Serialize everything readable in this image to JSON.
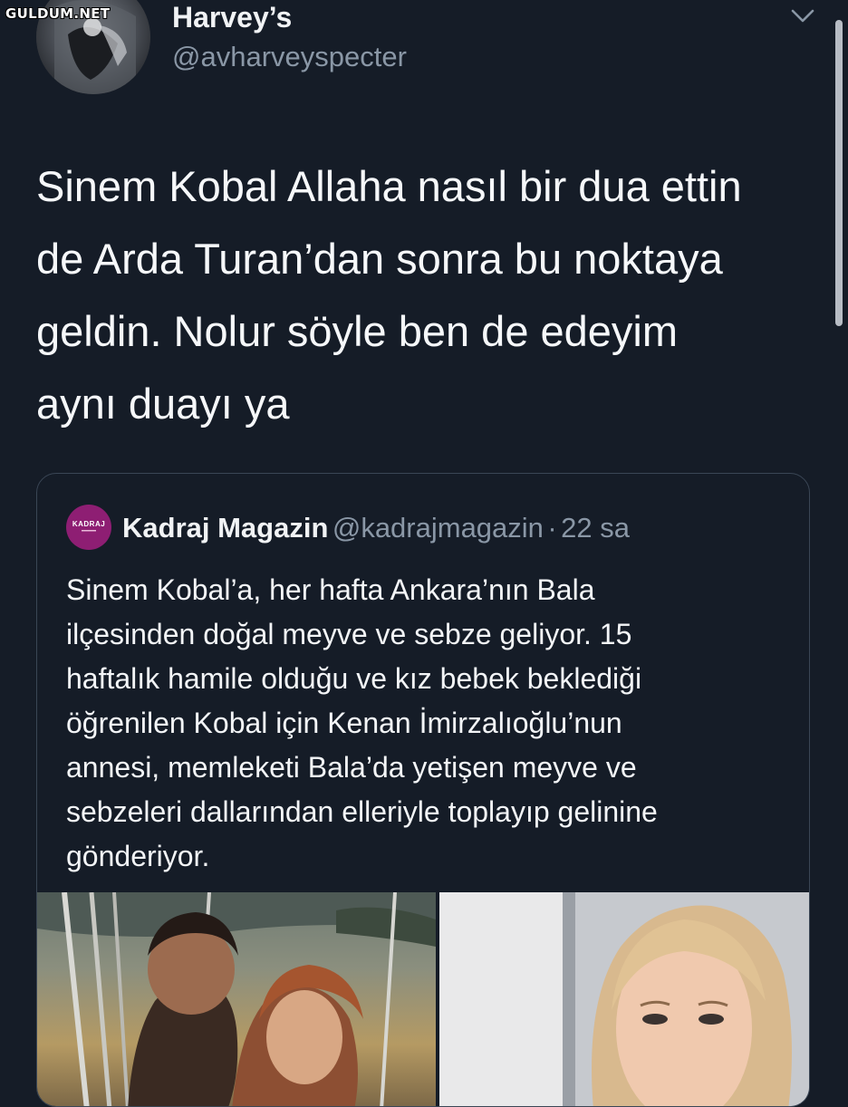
{
  "watermark": "GULDUM.NET",
  "tweet": {
    "author_name": "Harvey’s",
    "author_handle": "@avharveyspecter",
    "menu_icon": "chevron-down-icon",
    "text": "Sinem Kobal Allaha nasıl bir dua ettin\nde Arda Turan’dan sonra bu noktaya\ngeldin. Nolur söyle ben de edeyim\naynı duayı ya"
  },
  "quoted_tweet": {
    "avatar_text": "KADRAJ",
    "author_name": "Kadraj Magazin",
    "author_handle": "@kadrajmagazin",
    "separator": "·",
    "time": "22 sa",
    "text": "Sinem Kobal’a, her hafta Ankara’nın Bala\nilçesinden doğal meyve ve sebze geliyor. 15\nhaftalık hamile olduğu ve kız bebek beklediği\nöğrenilen Kobal için Kenan İmirzalıoğlu’nun\nannesi, memleketi Bala’da yetişen meyve ve\nsebzeleri dallarından elleriyle toplayıp gelinine\ngönderiyor."
  },
  "colors": {
    "background": "#151c27",
    "text_primary": "#f5f7f9",
    "text_secondary": "#8a97a6",
    "card_border": "#3a4655",
    "kadraj_brand": "#8e1e73"
  }
}
